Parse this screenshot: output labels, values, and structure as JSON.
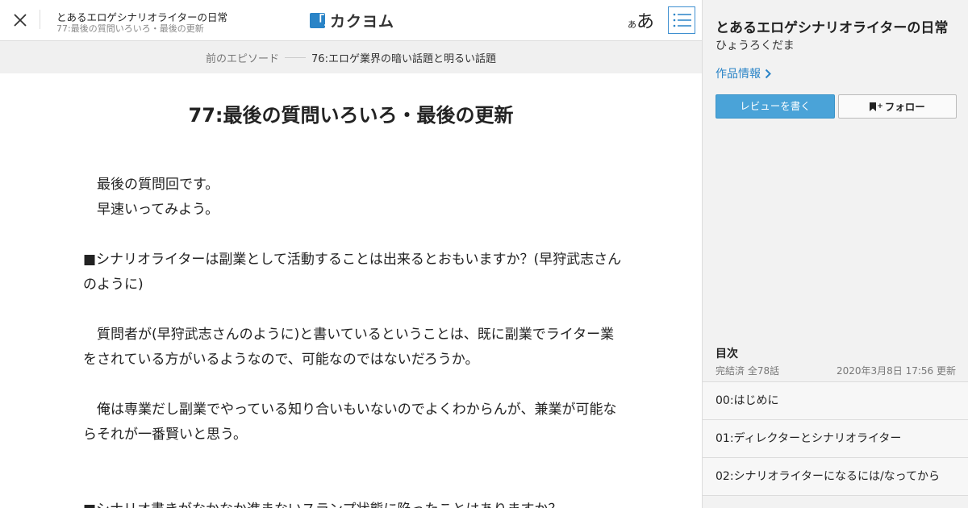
{
  "header": {
    "work_title": "とあるエロゲシナリオライターの日常",
    "episode_subtitle": "77:最後の質問いろいろ・最後の更新",
    "logo_text": "カクヨム",
    "logo_mark": "「」",
    "font_size_small": "あ",
    "font_size_big": "あ",
    "accent_color": "#2a84c7"
  },
  "prev_episode": {
    "label": "前のエピソード",
    "title": "76:エロゲ業界の暗い話題と明るい話題"
  },
  "episode": {
    "title": "77:最後の質問いろいろ・最後の更新",
    "paragraphs": [
      "　最後の質問回です。",
      "　早速いってみよう。",
      "",
      "■シナリオライターは副業として活動することは出来るとおもいますか？(早狩武志さんのように)",
      "",
      "　質問者が(早狩武志さんのように)と書いているということは、既に副業でライター業をされている方がいるようなので、可能なのではないだろうか。",
      "",
      "　俺は専業だし副業でやっている知り合いもいないのでよくわからんが、兼業が可能ならそれが一番賢いと思う。",
      "",
      "",
      "■シナリオ書きがなかなか進まないスランプ状態に陥ったことはありますか？"
    ]
  },
  "sidebar": {
    "work_title": "とあるエロゲシナリオライターの日常",
    "author": "ひょうろくだま",
    "work_info_link": "作品情報",
    "review_button": "レビューを書く",
    "follow_button": "フォロー",
    "follow_plus": "+",
    "toc_heading": "目次",
    "toc_status": "完結済 全78話",
    "toc_updated": "2020年3月8日 17:56 更新",
    "toc_items": [
      "00:はじめに",
      "01:ディレクターとシナリオライター",
      "02:シナリオライターになるには/なってから"
    ]
  }
}
